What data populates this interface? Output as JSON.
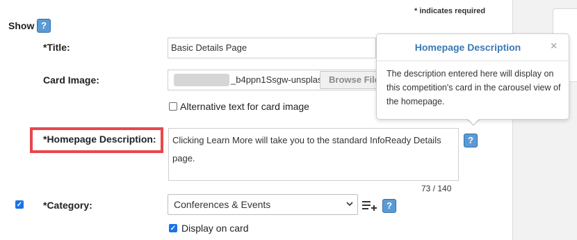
{
  "required_note": "* indicates required",
  "show_label": "Show",
  "help_glyph": "?",
  "title_field": {
    "label": "*Title:",
    "value": "Basic Details Page"
  },
  "card_image": {
    "label": "Card Image:",
    "file_name": "_b4ppn1Ssgw-unsplas",
    "browse_label": "Browse File"
  },
  "alt_text": {
    "label": "Alternative text for card image",
    "checked": false
  },
  "homepage_description": {
    "label": "*Homepage Description:",
    "value": "Clicking Learn More will take you to the standard InfoReady Details page.",
    "counter": "73 / 140"
  },
  "popover": {
    "title": "Homepage Description",
    "close": "×",
    "body": "The description entered here will display on this competition's card in the carousel view of the homepage."
  },
  "category": {
    "label": "*Category:",
    "selected": "Conferences & Events",
    "checked": true
  },
  "display_on_card": {
    "label": "Display on card",
    "checked": true
  },
  "icons": {
    "help": "help-icon",
    "add_list": "playlist-add-icon",
    "close": "close-icon",
    "dropdown": "chevron-down-icon"
  },
  "colors": {
    "accent": "#3a78b5",
    "highlight": "#e8474d",
    "checkbox": "#1a73e8",
    "help_button": "#5b9bd5"
  }
}
